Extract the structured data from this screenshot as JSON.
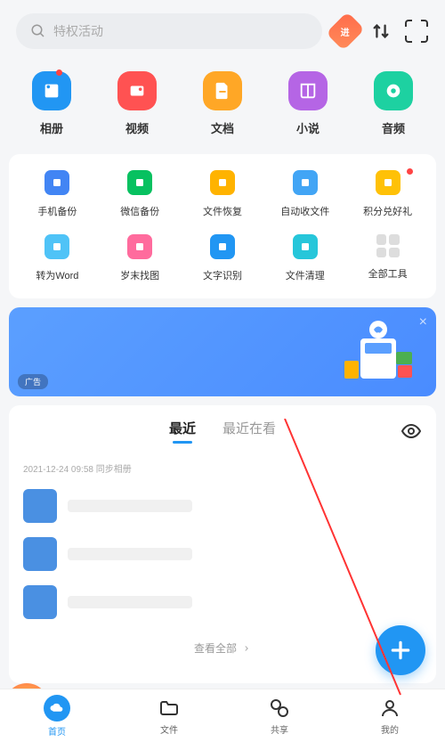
{
  "search": {
    "placeholder": "特权活动"
  },
  "mainIcons": [
    {
      "label": "相册",
      "color": "ic-blue",
      "dot": true
    },
    {
      "label": "视频",
      "color": "ic-red"
    },
    {
      "label": "文档",
      "color": "ic-orange"
    },
    {
      "label": "小说",
      "color": "ic-purple"
    },
    {
      "label": "音频",
      "color": "ic-teal"
    }
  ],
  "toolsRow1": [
    {
      "label": "手机备份",
      "cls": "ti-blue"
    },
    {
      "label": "微信备份",
      "cls": "ti-green"
    },
    {
      "label": "文件恢复",
      "cls": "ti-yellow"
    },
    {
      "label": "自动收文件",
      "cls": "ti-lblue"
    },
    {
      "label": "积分兑好礼",
      "cls": "ti-yellow2",
      "dot": true
    }
  ],
  "toolsRow2": [
    {
      "label": "转为Word",
      "cls": "ti-cyan"
    },
    {
      "label": "岁末找图",
      "cls": "ti-pink"
    },
    {
      "label": "文字识别",
      "cls": "ti-blue2"
    },
    {
      "label": "文件清理",
      "cls": "ti-teal"
    },
    {
      "label": "全部工具",
      "cls": "grid"
    }
  ],
  "banner": {
    "badge": "广告"
  },
  "tabs": {
    "recent": "最近",
    "recentOnline": "最近在看"
  },
  "recentTime": "2021-12-24 09:58  同步相册",
  "viewAll": "查看全部",
  "nav": [
    {
      "label": "首页"
    },
    {
      "label": "文件"
    },
    {
      "label": "共享"
    },
    {
      "label": "我的"
    }
  ]
}
